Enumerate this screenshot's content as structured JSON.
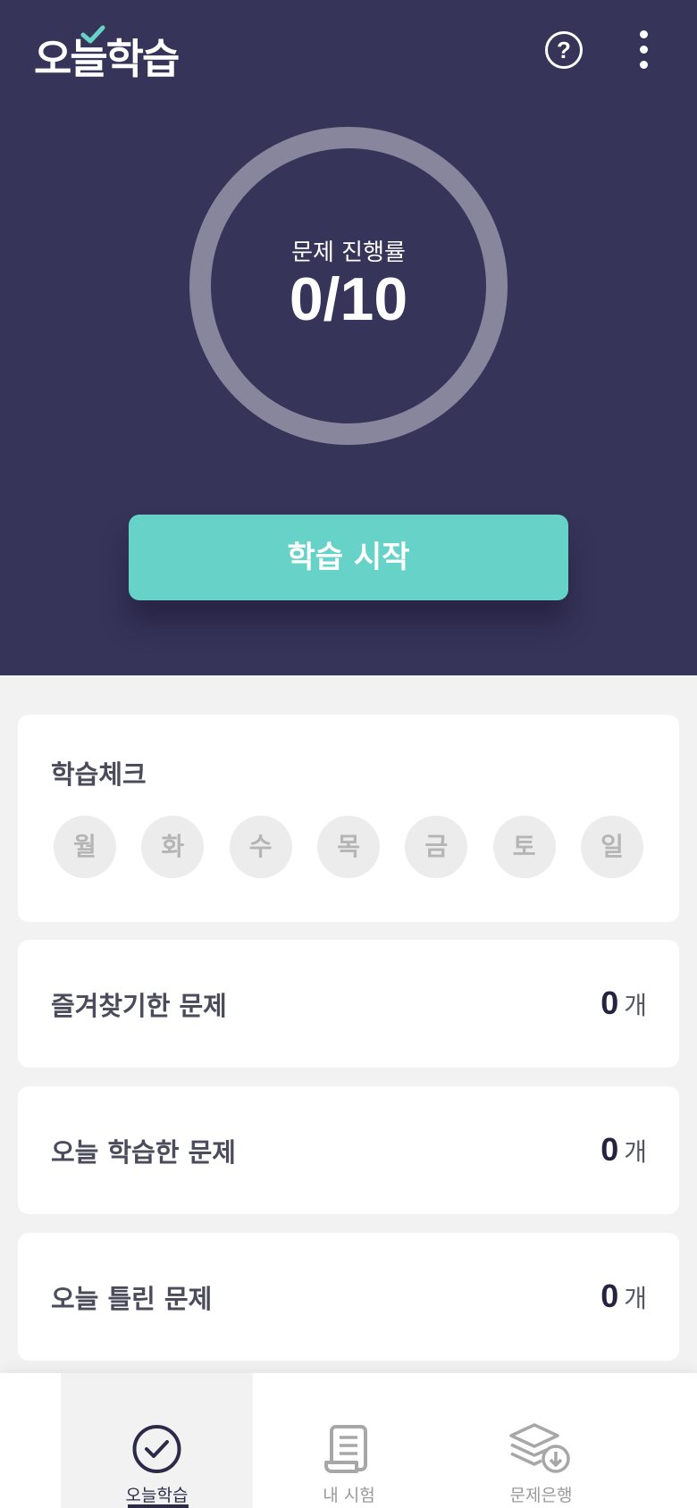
{
  "header": {
    "logo_text": "오늘학습",
    "help_icon": "question-circle-icon",
    "more_icon": "more-vertical-icon"
  },
  "progress": {
    "label": "문제 진행률",
    "value_text": "0/10",
    "done": 0,
    "total": 10
  },
  "start_button_label": "학습 시작",
  "study_check": {
    "title": "학습체크",
    "days": [
      "월",
      "화",
      "수",
      "목",
      "금",
      "토",
      "일"
    ]
  },
  "stats": [
    {
      "label": "즐겨찾기한 문제",
      "count": "0",
      "unit": "개"
    },
    {
      "label": "오늘 학습한 문제",
      "count": "0",
      "unit": "개"
    },
    {
      "label": "오늘 틀린 문제",
      "count": "0",
      "unit": "개"
    }
  ],
  "bottom_nav": [
    {
      "label": "오늘학습",
      "icon": "check-circle-icon",
      "active": true
    },
    {
      "label": "내 시험",
      "icon": "scroll-document-icon",
      "active": false
    },
    {
      "label": "문제은행",
      "icon": "layers-download-icon",
      "active": false
    }
  ],
  "colors": {
    "header_bg": "#37345a",
    "accent": "#67d3c8",
    "ring": "#88869c",
    "page_bg": "#f2f2f2"
  }
}
